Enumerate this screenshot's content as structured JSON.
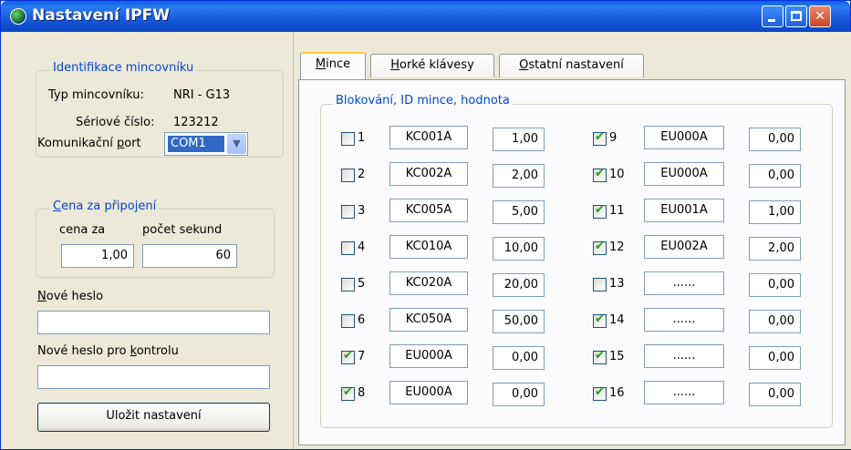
{
  "window": {
    "title": "Nastavení IPFW",
    "colors": {
      "titlebar": "#0A5FE4",
      "face": "#ECE9D8",
      "legend": "#0046D5",
      "check": "#21A121"
    }
  },
  "identification": {
    "legend": "Identifikace mincovníku",
    "type_label": "Typ mincovníku:",
    "type_value": "NRI - G13",
    "serial_label": "Sériové číslo:",
    "serial_value": "123212"
  },
  "port": {
    "label_pre": "Komunikační ",
    "label_u": "p",
    "label_post": "ort",
    "value": "COM1"
  },
  "price": {
    "legend_u": "C",
    "legend_rest": "ena za připojení",
    "cost_label": "cena za",
    "cost_value": "1,00",
    "seconds_label": "počet sekund",
    "seconds_value": "60"
  },
  "password": {
    "new_u": "N",
    "new_rest": "ové heslo",
    "new_value": "",
    "confirm_pre": "Nové heslo pro ",
    "confirm_u": "k",
    "confirm_post": "ontrolu",
    "confirm_value": ""
  },
  "save_button": "Uložit nastavení",
  "tabs": [
    {
      "u": "M",
      "rest": "ince",
      "active": true
    },
    {
      "u": "H",
      "rest": "orké klávesy",
      "active": false
    },
    {
      "u": "O",
      "rest": "statní nastavení",
      "active": false
    }
  ],
  "coins": {
    "legend": "Blokování, ID mince, hodnota",
    "left": [
      {
        "num": "1",
        "checked": false,
        "id": "KC001A",
        "value": "1,00"
      },
      {
        "num": "2",
        "checked": false,
        "id": "KC002A",
        "value": "2,00"
      },
      {
        "num": "3",
        "checked": false,
        "id": "KC005A",
        "value": "5,00"
      },
      {
        "num": "4",
        "checked": false,
        "id": "KC010A",
        "value": "10,00"
      },
      {
        "num": "5",
        "checked": false,
        "id": "KC020A",
        "value": "20,00"
      },
      {
        "num": "6",
        "checked": false,
        "id": "KC050A",
        "value": "50,00"
      },
      {
        "num": "7",
        "checked": true,
        "id": "EU000A",
        "value": "0,00"
      },
      {
        "num": "8",
        "checked": true,
        "id": "EU000A",
        "value": "0,00"
      }
    ],
    "right": [
      {
        "num": "9",
        "checked": true,
        "id": "EU000A",
        "value": "0,00"
      },
      {
        "num": "10",
        "checked": true,
        "id": "EU000A",
        "value": "0,00"
      },
      {
        "num": "11",
        "checked": true,
        "id": "EU001A",
        "value": "1,00"
      },
      {
        "num": "12",
        "checked": true,
        "id": "EU002A",
        "value": "2,00"
      },
      {
        "num": "13",
        "checked": false,
        "id": "......",
        "value": "0,00"
      },
      {
        "num": "14",
        "checked": true,
        "id": "......",
        "value": "0,00"
      },
      {
        "num": "15",
        "checked": true,
        "id": "......",
        "value": "0,00"
      },
      {
        "num": "16",
        "checked": true,
        "id": "......",
        "value": "0,00"
      }
    ]
  }
}
